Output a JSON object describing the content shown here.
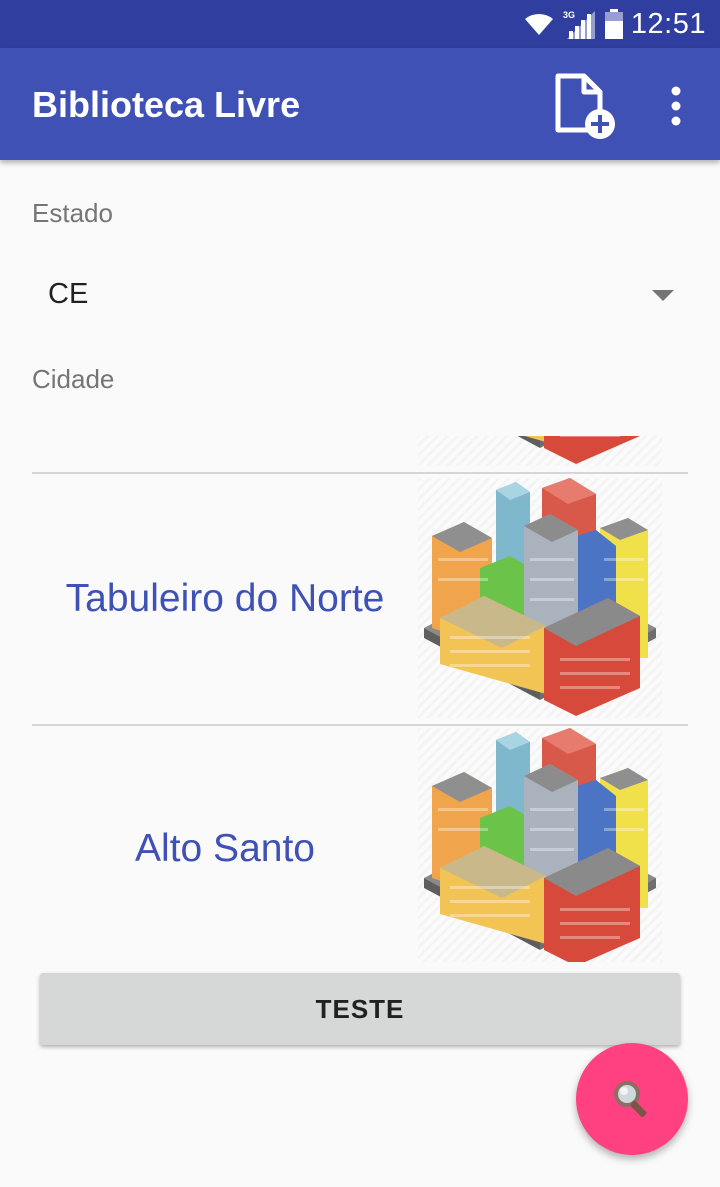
{
  "status_bar": {
    "time": "12:51",
    "network_type": "3G",
    "icons": [
      "wifi-icon",
      "signal-icon",
      "battery-icon"
    ]
  },
  "app_bar": {
    "title": "Biblioteca Livre",
    "actions": [
      "new-document-icon",
      "more-vert-icon"
    ]
  },
  "form": {
    "state_label": "Estado",
    "state_value": "CE",
    "city_label": "Cidade"
  },
  "cities": [
    {
      "name": ""
    },
    {
      "name": "Tabuleiro do Norte"
    },
    {
      "name": "Alto Santo"
    }
  ],
  "test_button": {
    "label": "TESTE"
  },
  "fab": {
    "icon": "search-icon"
  },
  "colors": {
    "status_bar": "#303f9f",
    "primary": "#3f51b5",
    "accent": "#ff4081",
    "city_text": "#3f51b5",
    "button_bg": "#d6d7d7"
  }
}
